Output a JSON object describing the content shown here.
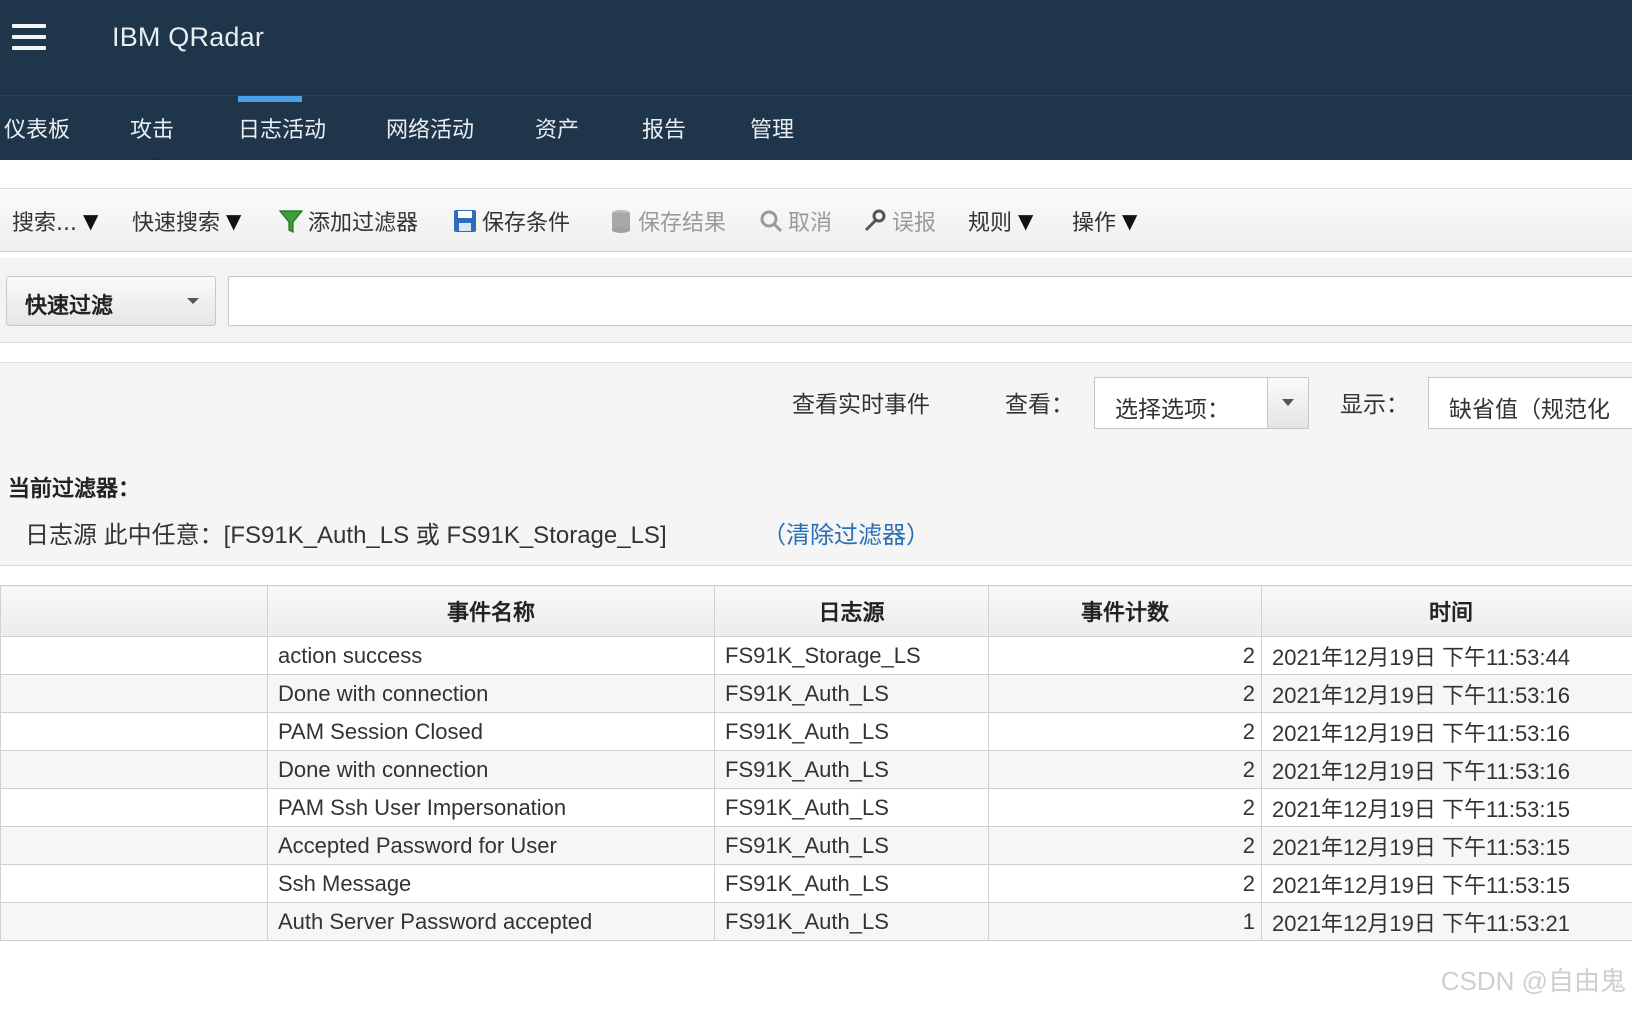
{
  "app": {
    "title": "IBM QRadar"
  },
  "nav": {
    "tabs": [
      {
        "label": "仪表板"
      },
      {
        "label": "攻击"
      },
      {
        "label": "日志活动",
        "active": true
      },
      {
        "label": "网络活动"
      },
      {
        "label": "资产"
      },
      {
        "label": "报告"
      },
      {
        "label": "管理"
      }
    ]
  },
  "toolbar": {
    "search": "搜索...",
    "quick_search": "快速搜索",
    "add_filter": "添加过滤器",
    "save_criteria": "保存条件",
    "save_results": "保存结果",
    "cancel": "取消",
    "false_positive": "误报",
    "rules": "规则",
    "actions": "操作",
    "dropdown_glyph": "▼"
  },
  "quick_filter": {
    "label": "快速过滤",
    "value": ""
  },
  "options": {
    "realtime": "查看实时事件",
    "view_label": "查看：",
    "view_value": "选择选项：",
    "display_label": "显示：",
    "display_value": "缺省值（规范化"
  },
  "filters": {
    "title": "当前过滤器：",
    "text": "日志源 此中任意：[FS91K_Auth_LS 或 FS91K_Storage_LS]",
    "clear_link": "（清除过滤器）"
  },
  "table": {
    "headers": [
      "",
      "事件名称",
      "日志源",
      "事件计数",
      "时间"
    ],
    "rows": [
      {
        "event": "action success",
        "source": "FS91K_Storage_LS",
        "count": "2",
        "time": "2021年12月19日 下午11:53:44"
      },
      {
        "event": "Done with connection",
        "source": "FS91K_Auth_LS",
        "count": "2",
        "time": "2021年12月19日 下午11:53:16"
      },
      {
        "event": "PAM Session Closed",
        "source": "FS91K_Auth_LS",
        "count": "2",
        "time": "2021年12月19日 下午11:53:16"
      },
      {
        "event": "Done with connection",
        "source": "FS91K_Auth_LS",
        "count": "2",
        "time": "2021年12月19日 下午11:53:16"
      },
      {
        "event": "PAM Ssh User Impersonation",
        "source": "FS91K_Auth_LS",
        "count": "2",
        "time": "2021年12月19日 下午11:53:15"
      },
      {
        "event": "Accepted Password for User",
        "source": "FS91K_Auth_LS",
        "count": "2",
        "time": "2021年12月19日 下午11:53:15"
      },
      {
        "event": "Ssh Message",
        "source": "FS91K_Auth_LS",
        "count": "2",
        "time": "2021年12月19日 下午11:53:15"
      },
      {
        "event": "Auth Server Password accepted",
        "source": "FS91K_Auth_LS",
        "count": "1",
        "time": "2021年12月19日 下午11:53:21"
      }
    ]
  },
  "watermark": "CSDN @自由鬼",
  "colors": {
    "header_bg": "#1f3549",
    "active_tab_bar": "#4a9ee8",
    "link": "#2a6fb5"
  }
}
